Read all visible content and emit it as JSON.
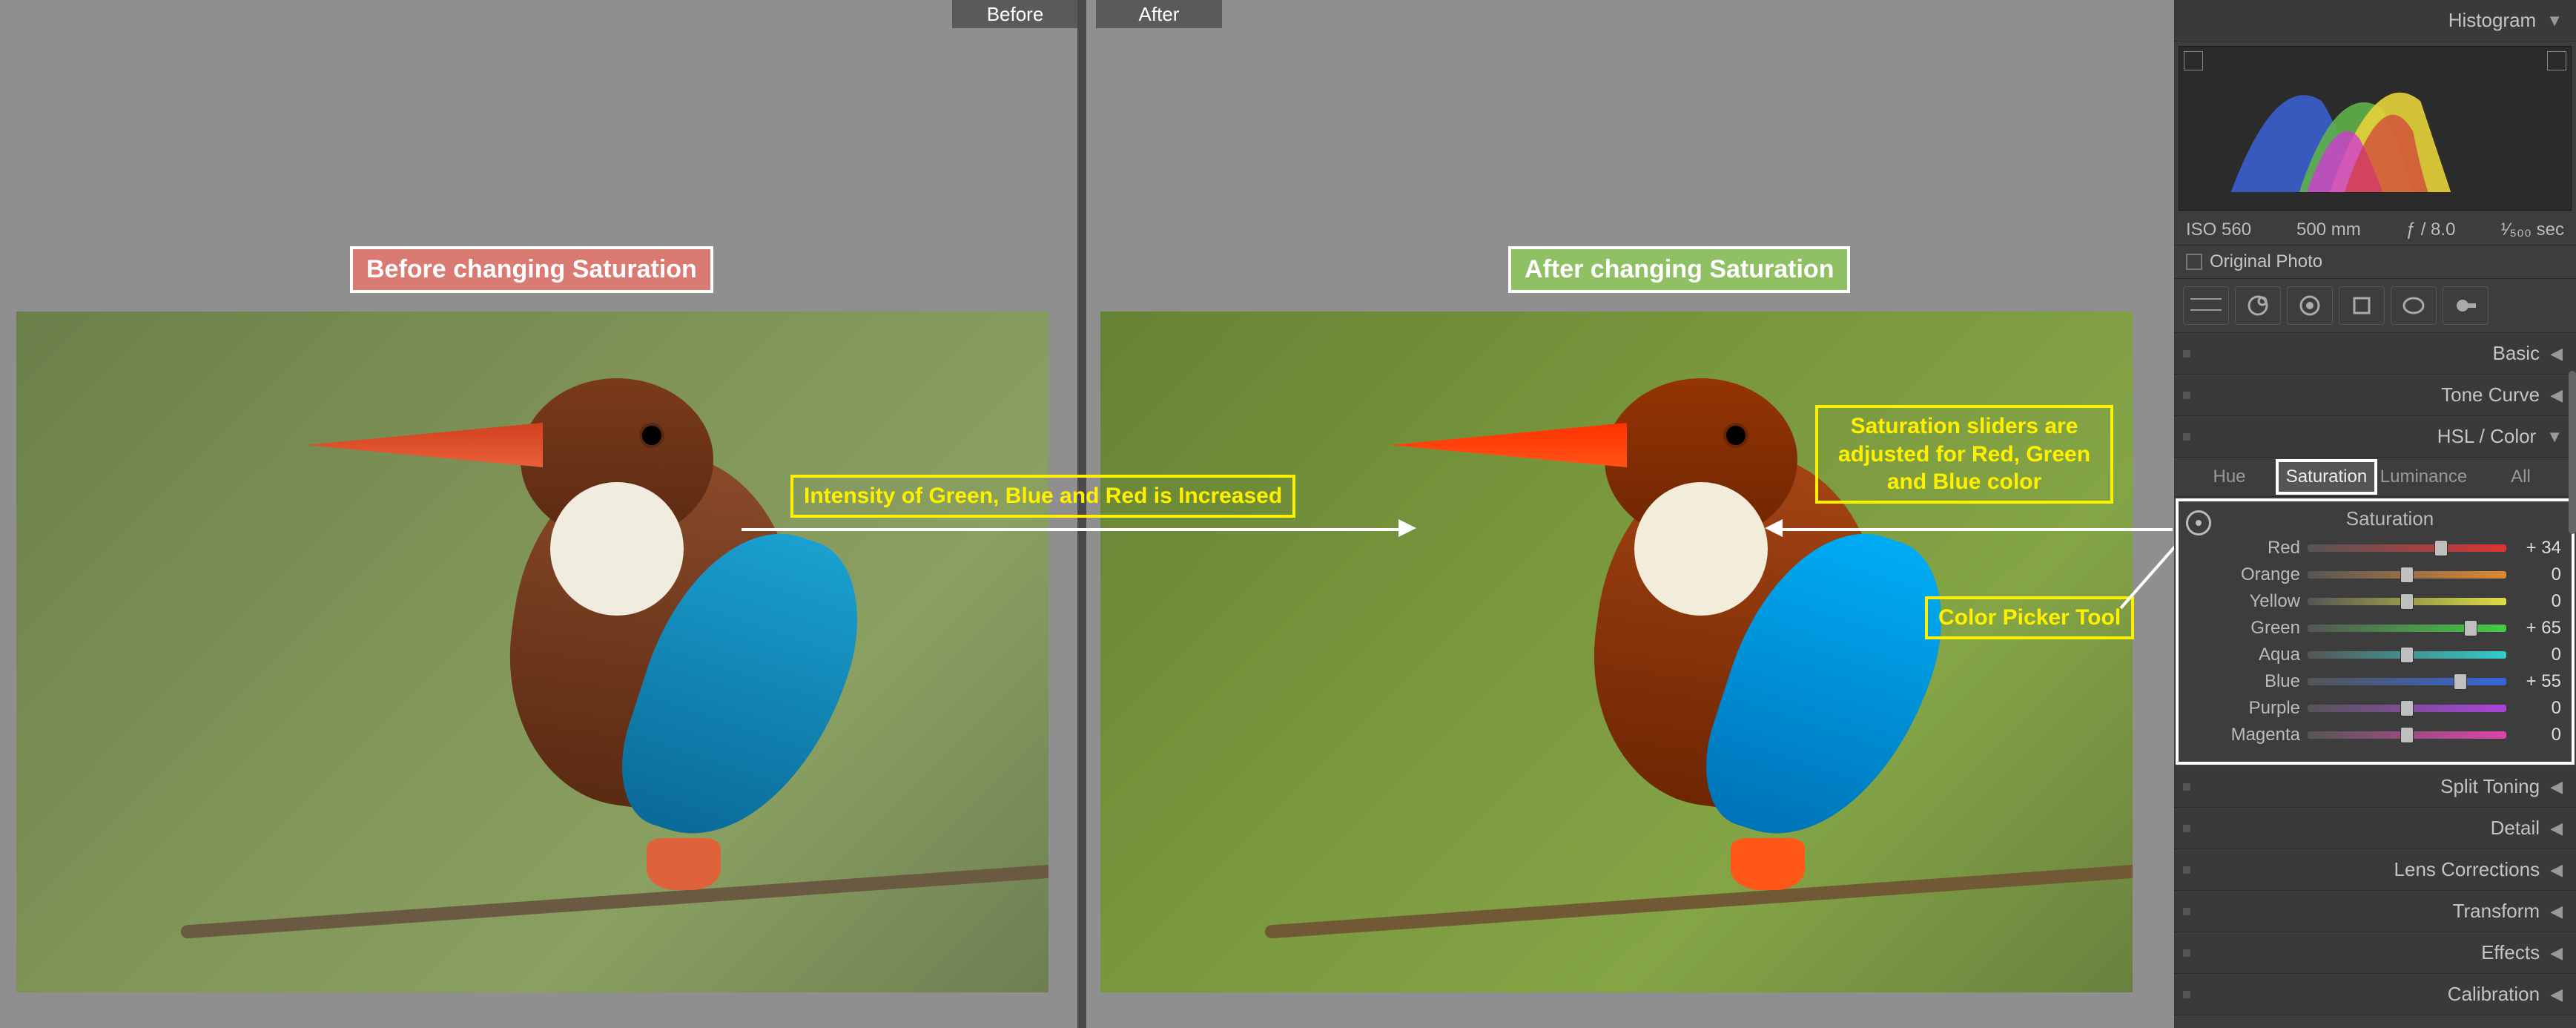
{
  "topbar": {
    "before": "Before",
    "after": "After"
  },
  "badge_before": "Before changing Saturation",
  "badge_after": "After changing Saturation",
  "ann_intensity": "Intensity of Green, Blue and Red is Increased",
  "ann_sliders": "Saturation sliders are adjusted for Red, Green and Blue color",
  "ann_picker": "Color Picker Tool",
  "panel": {
    "histogram_label": "Histogram",
    "exif": {
      "iso": "ISO 560",
      "focal": "500 mm",
      "aperture": "ƒ / 8.0",
      "shutter": "¹⁄₅₀₀ sec"
    },
    "original_photo": "Original Photo",
    "sections": {
      "basic": "Basic",
      "tone_curve": "Tone Curve",
      "hsl": "HSL / Color",
      "split_toning": "Split Toning",
      "detail": "Detail",
      "lens": "Lens Corrections",
      "transform": "Transform",
      "effects": "Effects",
      "calibration": "Calibration"
    },
    "hsl_tabs": {
      "hue": "Hue",
      "saturation": "Saturation",
      "luminance": "Luminance",
      "all": "All"
    },
    "hsl_title": "Saturation",
    "sliders": [
      {
        "label": "Red",
        "value": "+ 34",
        "pct": 67,
        "cls": "red"
      },
      {
        "label": "Orange",
        "value": "0",
        "pct": 50,
        "cls": "orange"
      },
      {
        "label": "Yellow",
        "value": "0",
        "pct": 50,
        "cls": "yellow"
      },
      {
        "label": "Green",
        "value": "+ 65",
        "pct": 82,
        "cls": "green"
      },
      {
        "label": "Aqua",
        "value": "0",
        "pct": 50,
        "cls": "aqua"
      },
      {
        "label": "Blue",
        "value": "+ 55",
        "pct": 77,
        "cls": "blue"
      },
      {
        "label": "Purple",
        "value": "0",
        "pct": 50,
        "cls": "purple"
      },
      {
        "label": "Magenta",
        "value": "0",
        "pct": 50,
        "cls": "magenta"
      }
    ]
  }
}
